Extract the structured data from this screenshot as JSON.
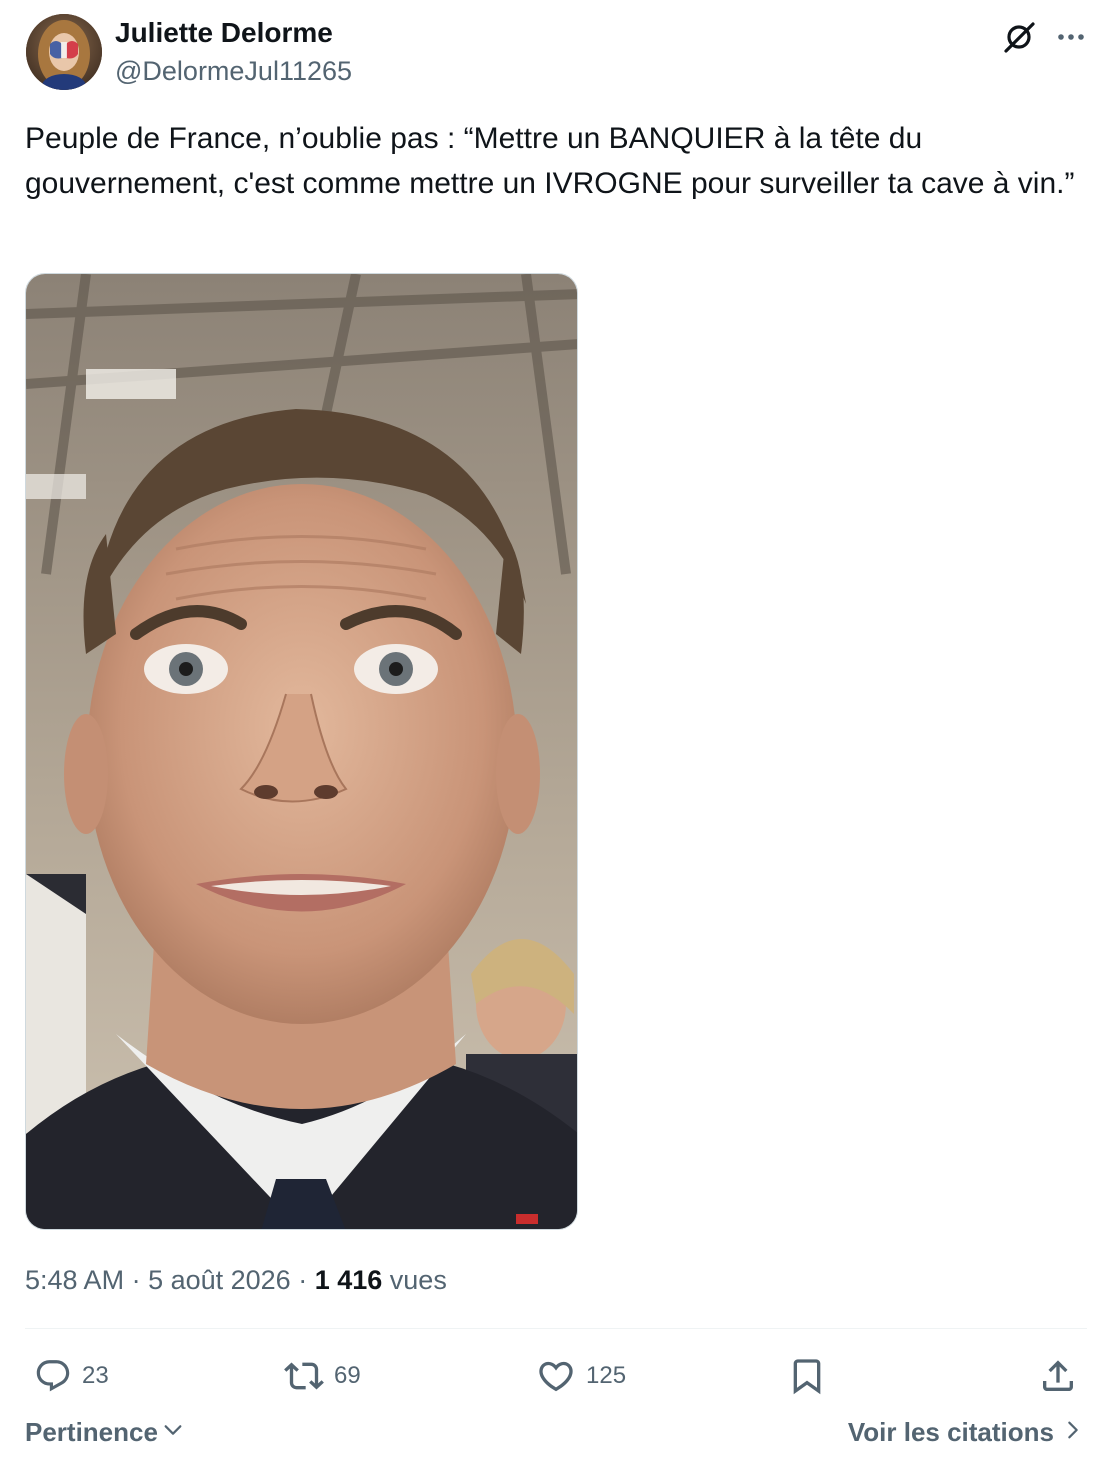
{
  "author": {
    "name": "Juliette Delorme",
    "handle": "@DelormeJul11265"
  },
  "tweet": {
    "text": "Peuple de France, n’oublie pas : “Mettre un BANQUIER à la tête du gouvernement, c'est comme mettre un IVROGNE pour surveiller ta cave à vin.”"
  },
  "meta": {
    "time": "5:48 AM",
    "separator": " · ",
    "date": "5 août 2026",
    "views_count": "1 416",
    "views_label": " vues"
  },
  "actions": {
    "reply": "23",
    "repost": "69",
    "like": "125"
  },
  "footer": {
    "sort_label": "Pertinence",
    "quotes_label": "Voir les citations"
  },
  "icons": {
    "grok": "grok-icon",
    "more": "more-icon",
    "reply": "reply-icon",
    "repost": "repost-icon",
    "like": "heart-icon",
    "bookmark": "bookmark-icon",
    "share": "share-icon",
    "sort_chevron": "chevron-down-icon",
    "quotes_chevron": "chevron-right-icon"
  },
  "colors": {
    "text_primary": "#0f1419",
    "text_secondary": "#536471",
    "divider": "#eff3f4"
  }
}
